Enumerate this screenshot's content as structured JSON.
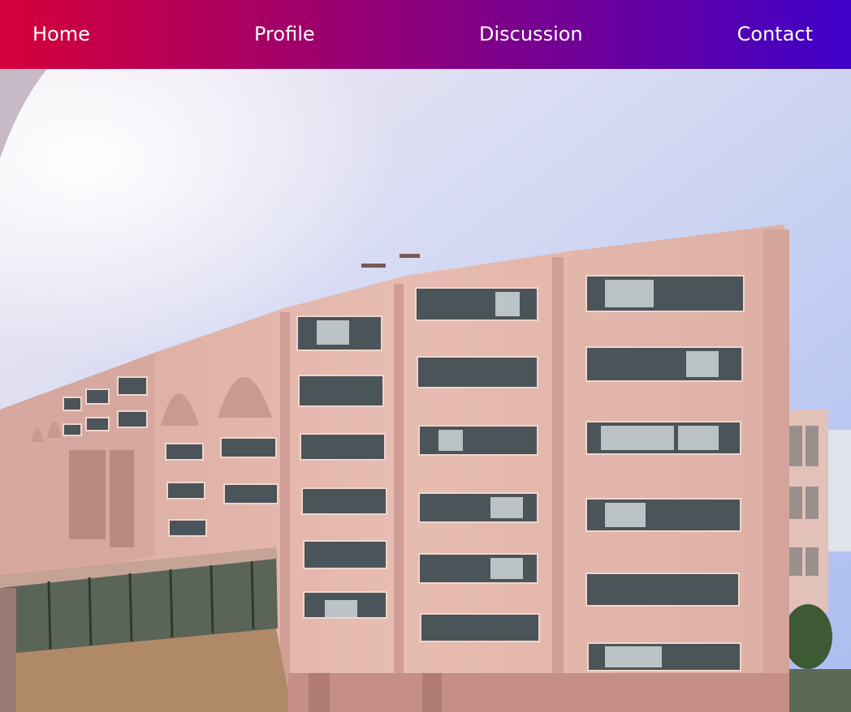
{
  "nav": {
    "links": [
      {
        "label": "Home"
      },
      {
        "label": "Profile"
      },
      {
        "label": "Discussion"
      },
      {
        "label": "Contact"
      }
    ],
    "gradient": [
      "#d5003a",
      "#8a007e",
      "#3f00c8"
    ]
  },
  "hero": {
    "subject": "campus building photo",
    "sky_color": "#b9c8ef",
    "building_color": "#e6b8ad"
  }
}
